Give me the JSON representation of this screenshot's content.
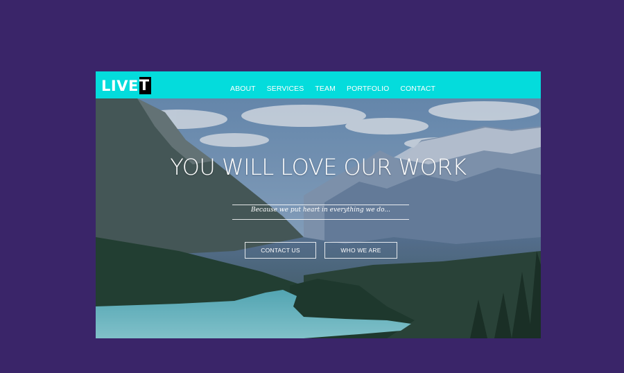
{
  "brand": {
    "logo_plain": "LIVE",
    "logo_boxed": "T"
  },
  "nav": {
    "items": [
      {
        "label": "ABOUT"
      },
      {
        "label": "SERVICES"
      },
      {
        "label": "TEAM"
      },
      {
        "label": "PORTFOLIO"
      },
      {
        "label": "CONTACT"
      }
    ]
  },
  "hero": {
    "headline": "YOU WILL LOVE OUR WORK",
    "tagline": "Because we put heart in everything we do...",
    "buttons": {
      "contact_label": "CONTACT US",
      "who_label": "WHO WE ARE"
    }
  },
  "colors": {
    "page_background": "#3a2569",
    "navbar": "#04dcdc",
    "lake": "#6cc7cf",
    "text": "#ffffff"
  },
  "icons": {
    "hero_image": "mountain-lake-landscape"
  }
}
